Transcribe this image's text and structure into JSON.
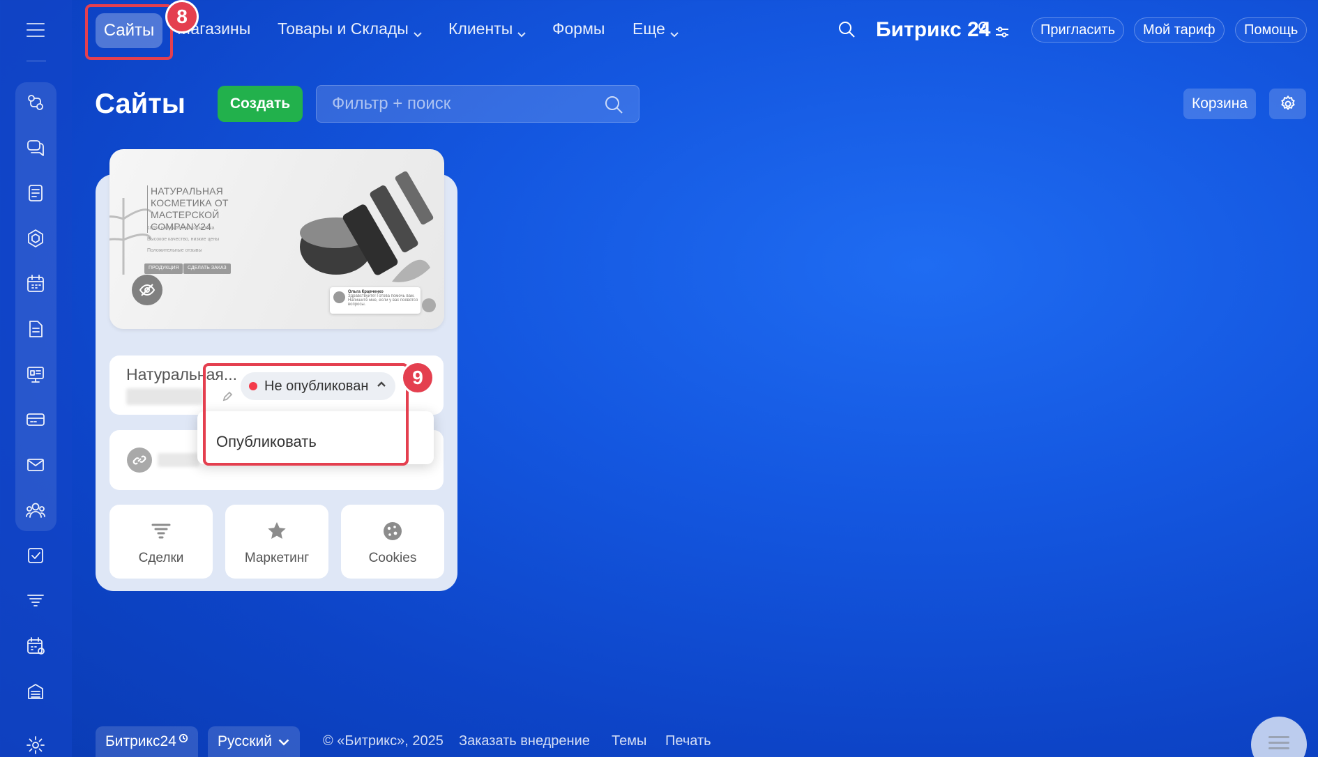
{
  "topbar": {
    "nav": {
      "active": "Сайты",
      "shops": "Магазины",
      "goods": "Товары и Склады",
      "clients": "Клиенты",
      "forms": "Формы",
      "more": "Еще"
    },
    "logo": "Битрикс 24",
    "invite": "Пригласить",
    "tariff": "Мой тариф",
    "help": "Помощь"
  },
  "callouts": {
    "step8": "8",
    "step9": "9",
    "color": "#e43f4f"
  },
  "page": {
    "title": "Сайты",
    "create": "Создать",
    "filter_placeholder": "Фильтр + поиск",
    "trash": "Корзина"
  },
  "site": {
    "preview": {
      "title": "НАТУРАЛЬНАЯ КОСМЕТИКА ОТ МАСТЕРСКОЙ COMPANY24",
      "lines": [
        "100% натуральная косметика",
        "Высокое качество, низкие цены",
        "Положительные отзывы"
      ],
      "btn1": "ПРОДУКЦИЯ",
      "btn2": "СДЕЛАТЬ ЗАКАЗ",
      "review_name": "Ольга Кравченко",
      "review_text": "Здравствуйте! Готова помочь вам. Напишите мне, если у вас появятся вопросы."
    },
    "name": "Натуральная...",
    "status": "Не опубликован",
    "dropdown_action": "Опубликовать",
    "tiles": {
      "deals": "Сделки",
      "marketing": "Маркетинг",
      "cookies": "Cookies"
    }
  },
  "footer": {
    "brand": "Битрикс24",
    "language": "Русский",
    "copyright": "© «Битрикс», 2025",
    "order": "Заказать внедрение",
    "themes": "Темы",
    "print": "Печать"
  },
  "colors": {
    "create_button": "#22b14c",
    "status_dot": "#f43b4a",
    "background": "#1457e0"
  }
}
